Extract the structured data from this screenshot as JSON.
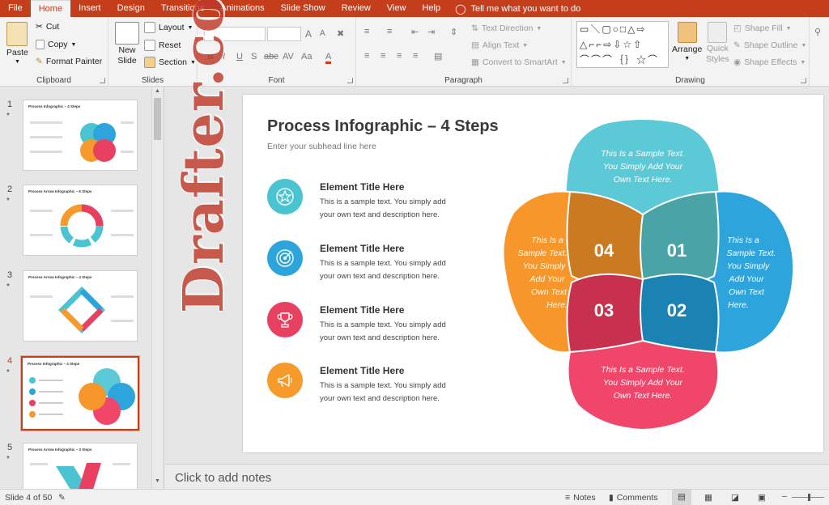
{
  "tabs": [
    "File",
    "Home",
    "Insert",
    "Design",
    "Transitions",
    "Animations",
    "Slide Show",
    "Review",
    "View",
    "Help"
  ],
  "tell_me": "Tell me what you want to do",
  "ribbon": {
    "clipboard": {
      "label": "Clipboard",
      "paste": "Paste",
      "cut": "Cut",
      "copy": "Copy",
      "format_painter": "Format Painter"
    },
    "slides": {
      "label": "Slides",
      "new_slide_line1": "New",
      "new_slide_line2": "Slide",
      "layout": "Layout",
      "reset": "Reset",
      "section": "Section"
    },
    "font": {
      "label": "Font",
      "bold": "B",
      "italic": "I",
      "underline": "U",
      "shadow": "S",
      "strike": "abc",
      "spacing": "AV",
      "case": "Aa",
      "color": "A",
      "grow": "A",
      "shrink": "A"
    },
    "paragraph": {
      "label": "Paragraph",
      "text_direction": "Text Direction",
      "align_text": "Align Text",
      "convert_smartart": "Convert to SmartArt"
    },
    "drawing": {
      "label": "Drawing",
      "arrange": "Arrange",
      "quick_styles_line1": "Quick",
      "quick_styles_line2": "Styles",
      "shape_fill": "Shape Fill",
      "shape_outline": "Shape Outline",
      "shape_effects": "Shape Effects"
    }
  },
  "thumbnails": [
    {
      "number": "1",
      "star": "*",
      "title": "Process Infographic – 4 Steps"
    },
    {
      "number": "2",
      "star": "*",
      "title": "Process Arrow Infographic – 6 Steps"
    },
    {
      "number": "3",
      "star": "*",
      "title": "Process Arrow Infographic – 4 Steps"
    },
    {
      "number": "4",
      "star": "*",
      "title": "Process Infographic – 4 Steps"
    },
    {
      "number": "5",
      "star": "*",
      "title": "Process Arrow Infographic – 3 Steps"
    }
  ],
  "slide": {
    "title": "Process Infographic – 4 Steps",
    "subtitle": "Enter your subhead line here",
    "elements": [
      {
        "title": "Element Title Here",
        "desc": "This is a sample text. You simply add your own text and description here.",
        "color": "#4bc4d1",
        "icon": "star-icon"
      },
      {
        "title": "Element Title Here",
        "desc": "This is a sample text. You simply add your own text and description here.",
        "color": "#2ea4dd",
        "icon": "target-icon"
      },
      {
        "title": "Element Title Here",
        "desc": "This is a sample text. You simply add your own text and description here.",
        "color": "#e84060",
        "icon": "trophy-icon"
      },
      {
        "title": "Element Title Here",
        "desc": "This is a sample text. You simply add your own text and description here.",
        "color": "#f59a2b",
        "icon": "megaphone-icon"
      }
    ],
    "petals": {
      "top": {
        "lines": [
          "This Is a Sample Text.",
          "You Simply Add Your",
          "Own Text Here."
        ],
        "color": "#5ccad6"
      },
      "right": {
        "lines": [
          "This Is a",
          "Sample Text.",
          "You Simply",
          "Add Your",
          "Own Text",
          "Here."
        ],
        "color": "#2ea4dd"
      },
      "bottom": {
        "lines": [
          "This Is a Sample Text.",
          "You Simply Add Your",
          "Own Text Here."
        ],
        "color": "#f0466a"
      },
      "left": {
        "lines": [
          "This Is a",
          "Sample Text.",
          "You Simply",
          "Add Your",
          "Own Text",
          "Here."
        ],
        "color": "#f7962a"
      }
    },
    "steps": {
      "s01": "01",
      "s02": "02",
      "s03": "03",
      "s04": "04"
    },
    "step_colors": {
      "s01": "#4aa3a6",
      "s02": "#1a83b3",
      "s03": "#c8314d",
      "s04": "#cc7a22"
    }
  },
  "watermark": "Drafter.com",
  "notes_placeholder": "Click to add notes",
  "status": {
    "slide_info": "Slide 4 of 50",
    "notes": "Notes",
    "comments": "Comments"
  },
  "colors": {
    "accent": "#c43e1c"
  }
}
